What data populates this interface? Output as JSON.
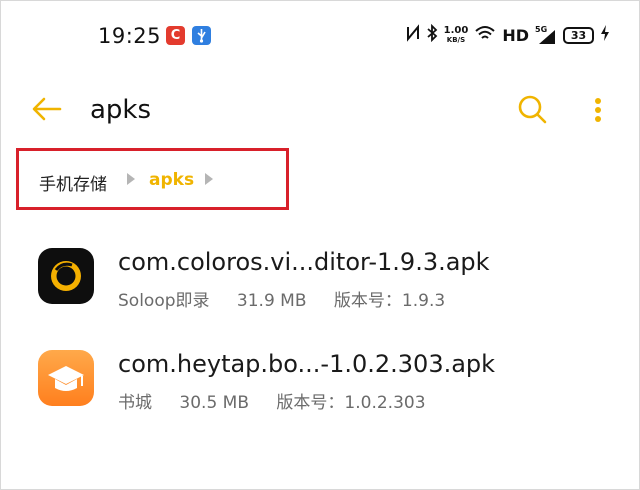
{
  "status_bar": {
    "time": "19:25",
    "notif_c": "C",
    "speed_value": "1.00",
    "speed_unit": "KB/S",
    "hd_label": "HD",
    "signal_label": "5G",
    "battery": "33"
  },
  "toolbar": {
    "title": "apks",
    "accent_color": "#f0b400"
  },
  "breadcrumb": {
    "items": [
      "手机存储",
      "apks"
    ]
  },
  "files": [
    {
      "name": "com.coloros.vi...ditor-1.9.3.apk",
      "app": "Soloop即录",
      "size": "31.9 MB",
      "version": "版本号：1.9.3",
      "icon": "soloop-app-icon"
    },
    {
      "name": "com.heytap.bo...-1.0.2.303.apk",
      "app": "书城",
      "size": "30.5 MB",
      "version": "版本号：1.0.2.303",
      "icon": "bookstore-app-icon"
    }
  ]
}
